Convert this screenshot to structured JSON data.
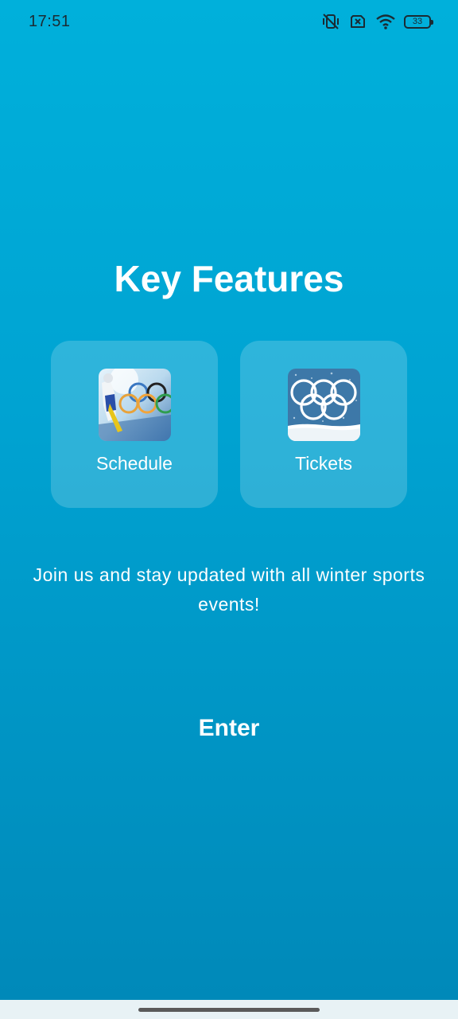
{
  "status_bar": {
    "time": "17:51",
    "battery": "33",
    "icons": [
      "vibrate-off-icon",
      "sim-off-icon",
      "wifi-icon",
      "battery-icon"
    ]
  },
  "title": "Key Features",
  "features": [
    {
      "label": "Schedule",
      "icon": "olympic-rings-skier-image"
    },
    {
      "label": "Tickets",
      "icon": "olympic-rings-snow-image"
    }
  ],
  "tagline": "Join us and stay updated with all winter sports events!",
  "enter_label": "Enter",
  "colors": {
    "background_top": "#00b0db",
    "background_bottom": "#0088b8",
    "text": "#ffffff"
  }
}
